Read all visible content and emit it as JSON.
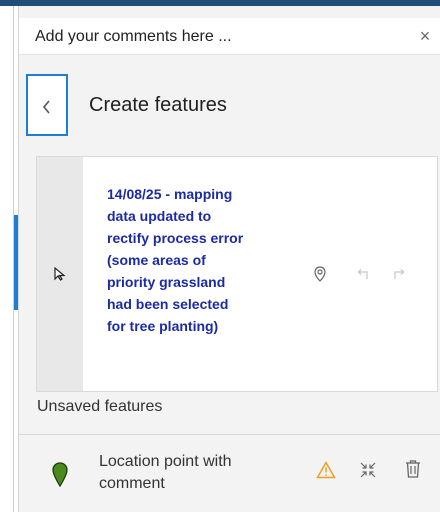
{
  "header": {
    "title": "Add your comments here ..."
  },
  "subheader": {
    "title": "Create features"
  },
  "card": {
    "comment_lines": [
      "14/08/25 - mapping",
      "data updated to",
      "rectify process error",
      "(some areas of",
      "priority grassland",
      "had been selected",
      "for tree planting)"
    ]
  },
  "section": {
    "title": "Unsaved features"
  },
  "row": {
    "label_lines": [
      "Location point with",
      "comment"
    ]
  },
  "icons": {
    "close": "close-icon",
    "back": "chevron-left-icon",
    "select": "cursor-arrow-icon",
    "vertex": "pin-outline-icon",
    "undo": "undo-icon",
    "redo": "redo-icon",
    "pin": "green-map-pin-icon",
    "warning": "warning-triangle-icon",
    "collapse": "collapse-arrows-icon",
    "delete": "trash-icon"
  },
  "colors": {
    "accent": "#1f7ed4",
    "comment_text": "#1b2aa6",
    "pin_green": "#4a8a1f",
    "warning": "#f0a020"
  }
}
